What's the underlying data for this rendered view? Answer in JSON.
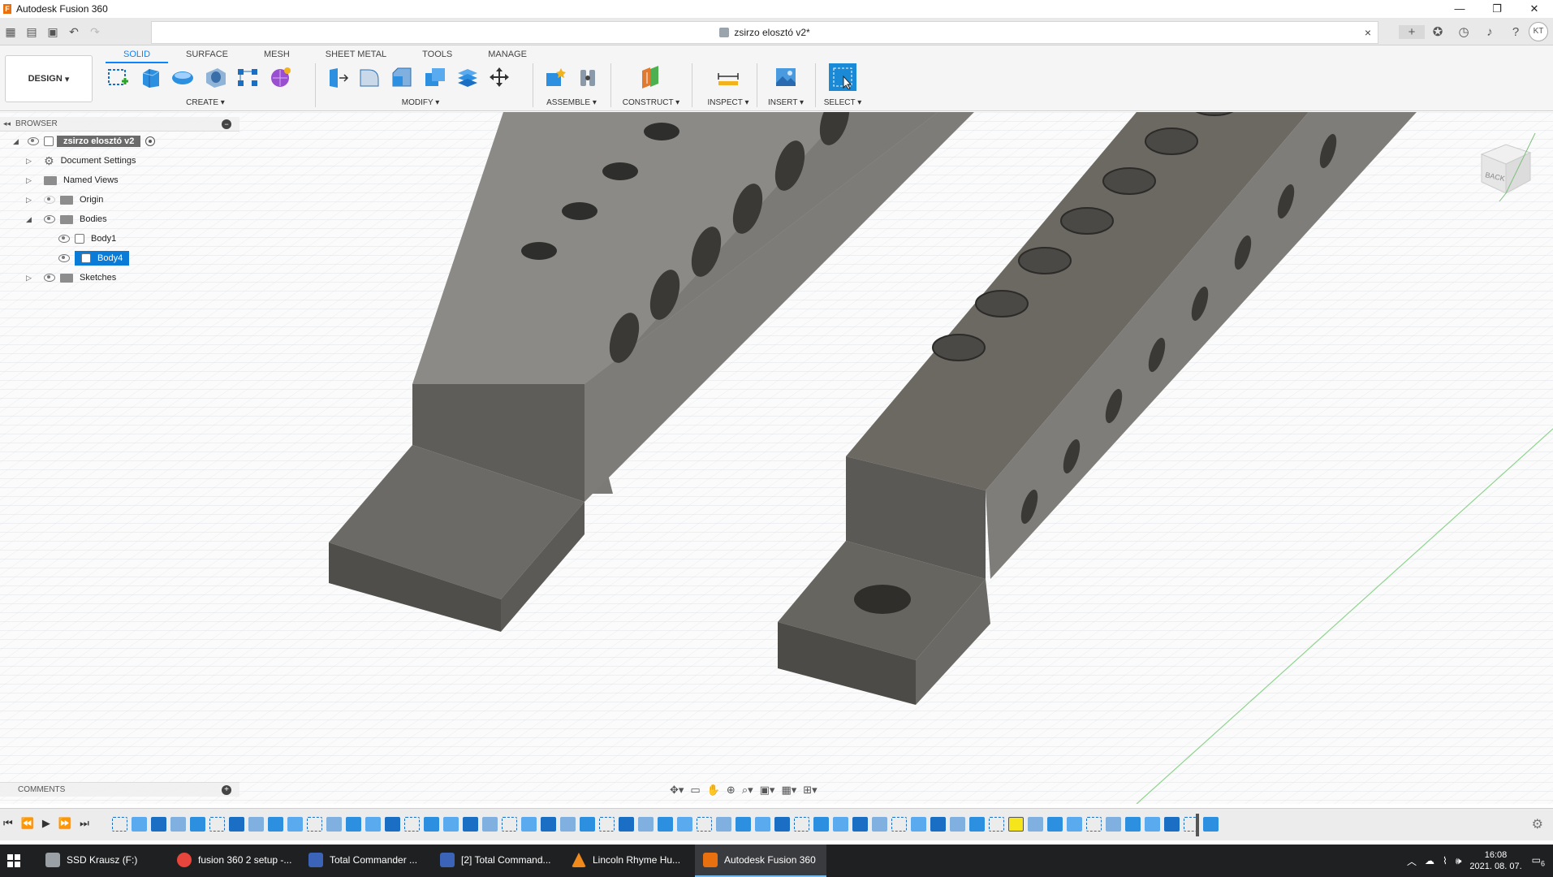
{
  "window": {
    "app_title": "Autodesk Fusion 360",
    "minimize": "—",
    "restore": "❐",
    "close": "✕"
  },
  "document": {
    "title": "zsirzo elosztó v2*",
    "close": "×",
    "user_initials": "KT"
  },
  "ribbon": {
    "workspace": "DESIGN",
    "tabs": [
      "SOLID",
      "SURFACE",
      "MESH",
      "SHEET METAL",
      "TOOLS",
      "MANAGE"
    ],
    "groups": {
      "create": "CREATE",
      "modify": "MODIFY",
      "assemble": "ASSEMBLE",
      "construct": "CONSTRUCT",
      "inspect": "INSPECT",
      "insert": "INSERT",
      "select": "SELECT"
    }
  },
  "browser": {
    "title": "BROWSER",
    "root": "zsirzo elosztó v2",
    "items": {
      "document_settings": "Document Settings",
      "named_views": "Named Views",
      "origin": "Origin",
      "bodies": "Bodies",
      "body1": "Body1",
      "body4": "Body4",
      "sketches": "Sketches"
    }
  },
  "viewcube": {
    "face": "BACK"
  },
  "comments": {
    "title": "COMMENTS"
  },
  "taskbar": {
    "items": [
      {
        "label": "SSD Krausz (F:)",
        "color": "#9aa0a6"
      },
      {
        "label": "fusion 360 2 setup -...",
        "color": "#e8453c"
      },
      {
        "label": "Total Commander ...",
        "color": "#3b63b8"
      },
      {
        "label": "[2] Total Command...",
        "color": "#3b63b8"
      },
      {
        "label": "Lincoln Rhyme Hu...",
        "color": "#f08a1c"
      },
      {
        "label": "Autodesk Fusion 360",
        "color": "#e8700f"
      }
    ],
    "time": "16:08",
    "date": "2021. 08. 07.",
    "notifications": "6"
  },
  "colors": {
    "accent": "#0a84ff",
    "selection": "#0a7bd6",
    "grid_line": "#d9dde3",
    "part_dark": "#5a5a57",
    "part_light": "#8a8a86"
  }
}
